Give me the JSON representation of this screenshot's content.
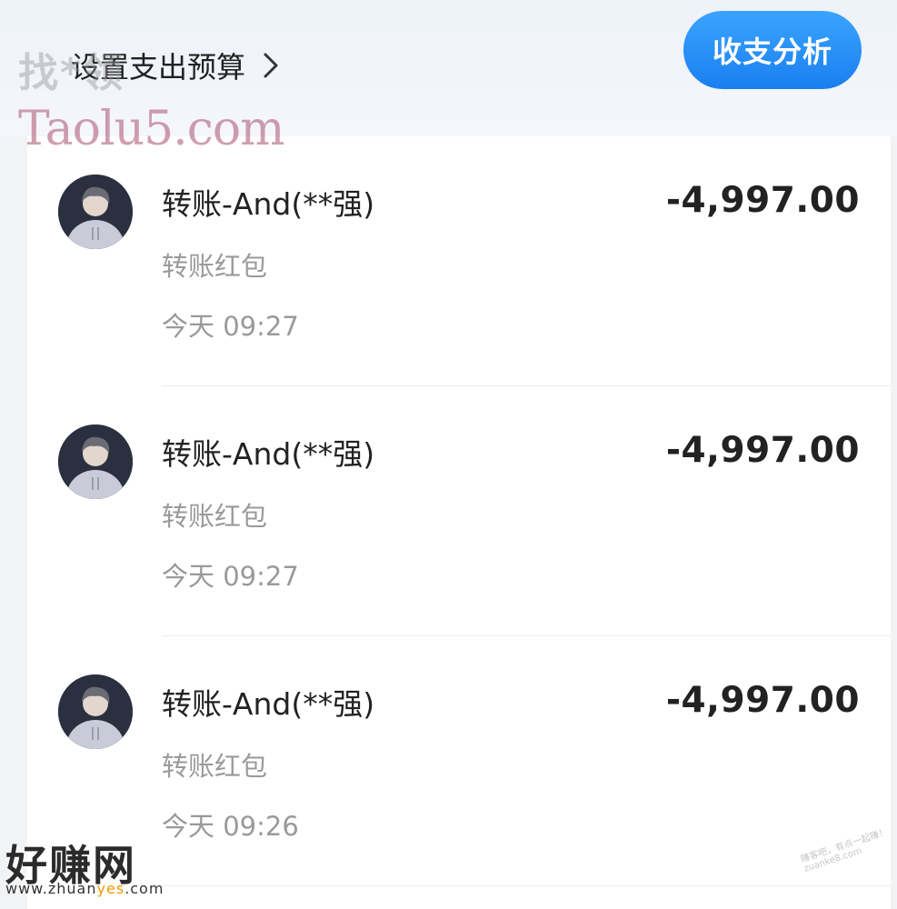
{
  "header": {
    "budget_label": "设置支出预算",
    "analysis_label": "收支分析"
  },
  "transactions": [
    {
      "title": "转账-And(**强)",
      "subtitle": "转账红包",
      "time": "今天 09:27",
      "amount": "-4,997.00"
    },
    {
      "title": "转账-And(**强)",
      "subtitle": "转账红包",
      "time": "今天 09:27",
      "amount": "-4,997.00"
    },
    {
      "title": "转账-And(**强)",
      "subtitle": "转账红包",
      "time": "今天 09:26",
      "amount": "-4,997.00"
    }
  ],
  "watermarks": {
    "top_cn": "找*领",
    "top_en": "Taolu5.com",
    "bottom_cn": "好赚网",
    "bottom_url_a": "www.zhuan",
    "bottom_url_b": "yes",
    "bottom_url_c": ".com",
    "corner": "赚客吧，有点一起赚！ zuanke8.com"
  },
  "colors": {
    "accent": "#1a7ff0",
    "amount": "#222222",
    "muted": "#9a9a9a"
  },
  "icons": {
    "chevron": "chevron-right-icon",
    "avatar": "user-avatar"
  }
}
